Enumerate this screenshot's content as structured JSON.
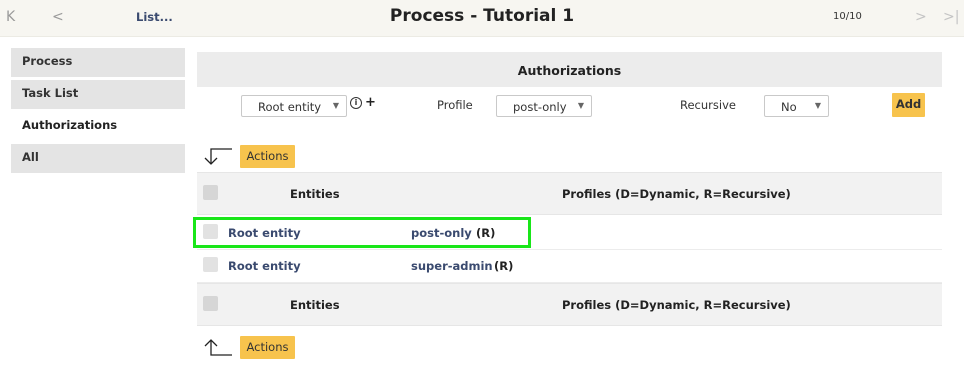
{
  "header": {
    "list_link": "List...",
    "title": "Process - Tutorial 1",
    "pager": "10/10",
    "nav_first": "K",
    "nav_prev": "<",
    "nav_next": ">",
    "nav_last": ">|"
  },
  "sidebar": {
    "items": [
      {
        "label": "Process",
        "active": false
      },
      {
        "label": "Task List",
        "active": false
      },
      {
        "label": "Authorizations",
        "active": true
      },
      {
        "label": "All",
        "active": false
      }
    ]
  },
  "authorizations": {
    "title": "Authorizations",
    "entity_select": "Root entity",
    "profile_label": "Profile",
    "profile_select": "post-only",
    "recursive_label": "Recursive",
    "recursive_select": "No",
    "add_button": "Add",
    "info_icon_glyph": "i",
    "plus_glyph": "+"
  },
  "actions": {
    "top_label": "Actions",
    "bottom_label": "Actions"
  },
  "table": {
    "columns": [
      "Entities",
      "Profiles (D=Dynamic, R=Recursive)"
    ],
    "rows": [
      {
        "entity": "Root entity",
        "profile": "post-only",
        "flag": "(R)",
        "highlighted": true
      },
      {
        "entity": "Root entity",
        "profile": "super-admin",
        "flag": "(R)",
        "highlighted": false
      }
    ]
  },
  "colors": {
    "accent_button": "#f7c34d",
    "link": "#3a4a6f",
    "highlight_border": "#19e619",
    "header_bg": "#f7f6f1"
  }
}
